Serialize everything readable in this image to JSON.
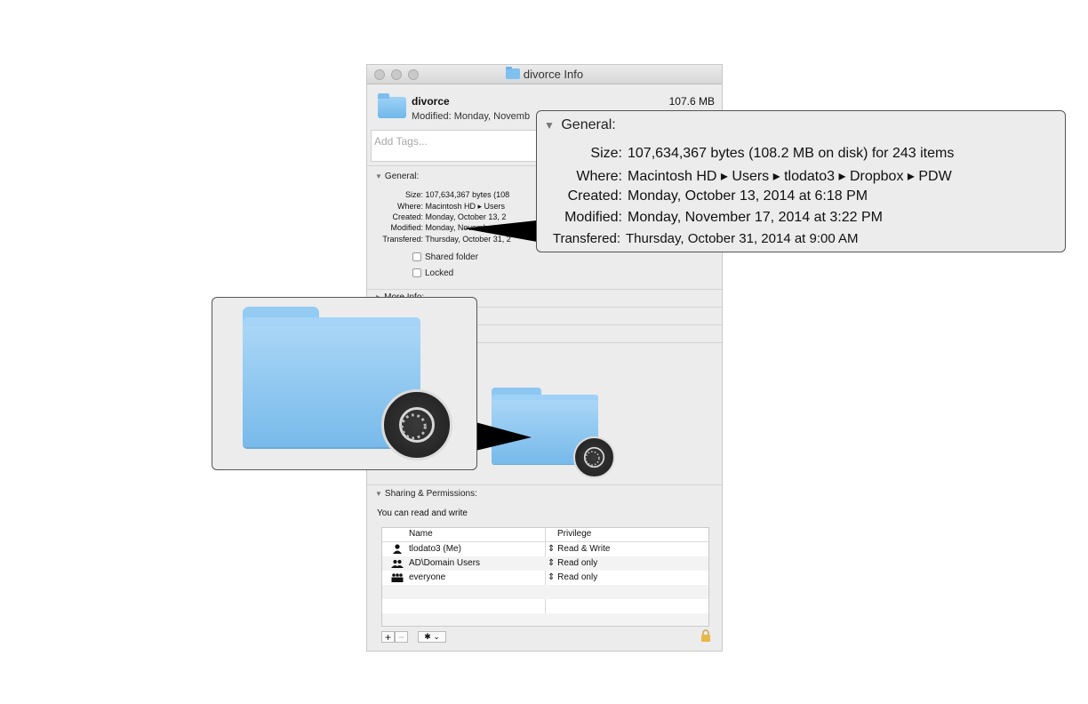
{
  "window": {
    "title": "divorce Info",
    "name": "divorce",
    "size": "107.6 MB",
    "modified": "Modified: Monday, Novemb",
    "tags_placeholder": "Add Tags..."
  },
  "general": {
    "title": "General:",
    "rows": [
      {
        "label": "Size:",
        "value": "107,634,367 bytes (108"
      },
      {
        "label": "Where:",
        "value": "Macintosh HD ▸ Users"
      },
      {
        "label": "Created:",
        "value": "Monday, October 13, 2"
      },
      {
        "label": "Modified:",
        "value": "Monday, Novemb"
      },
      {
        "label": "Transfered:",
        "value": "Thursday, October 31, 2"
      }
    ],
    "shared_folder": "Shared folder",
    "locked": "Locked"
  },
  "more_info_title": "More Info:",
  "sharing": {
    "title": "Sharing & Permissions:",
    "summary": "You can read and write",
    "col_name": "Name",
    "col_privilege": "Privilege",
    "rows": [
      {
        "name": "tlodato3 (Me)",
        "privilege": "Read & Write"
      },
      {
        "name": "AD\\Domain Users",
        "privilege": "Read only"
      },
      {
        "name": "everyone",
        "privilege": "Read only"
      }
    ]
  },
  "buttons": {
    "add": "+",
    "remove": "−"
  },
  "callout_general": {
    "title": "General:",
    "rows": [
      {
        "label": "Size:",
        "value": "107,634,367 bytes (108.2 MB on disk) for 243 items"
      },
      {
        "label": "Where:",
        "value": "Macintosh HD ▸ Users ▸ tlodato3 ▸ Dropbox ▸ PDW"
      },
      {
        "label": "Created:",
        "value": "Monday, October 13, 2014 at 6:18 PM"
      },
      {
        "label": "Modified:",
        "value": "Monday, November 17, 2014 at 3:22 PM"
      },
      {
        "label": "Transfered:",
        "value": "Thursday, October 31, 2014 at 9:00 AM"
      }
    ]
  },
  "colors": {
    "folder_blue": "#8ec8f2",
    "window_bg": "#ececec",
    "badge_dark": "#262626"
  },
  "icons": [
    "folder-icon",
    "sync-badge-icon",
    "user-icon",
    "group-icon",
    "everyone-icon",
    "gear-icon",
    "lock-icon"
  ]
}
